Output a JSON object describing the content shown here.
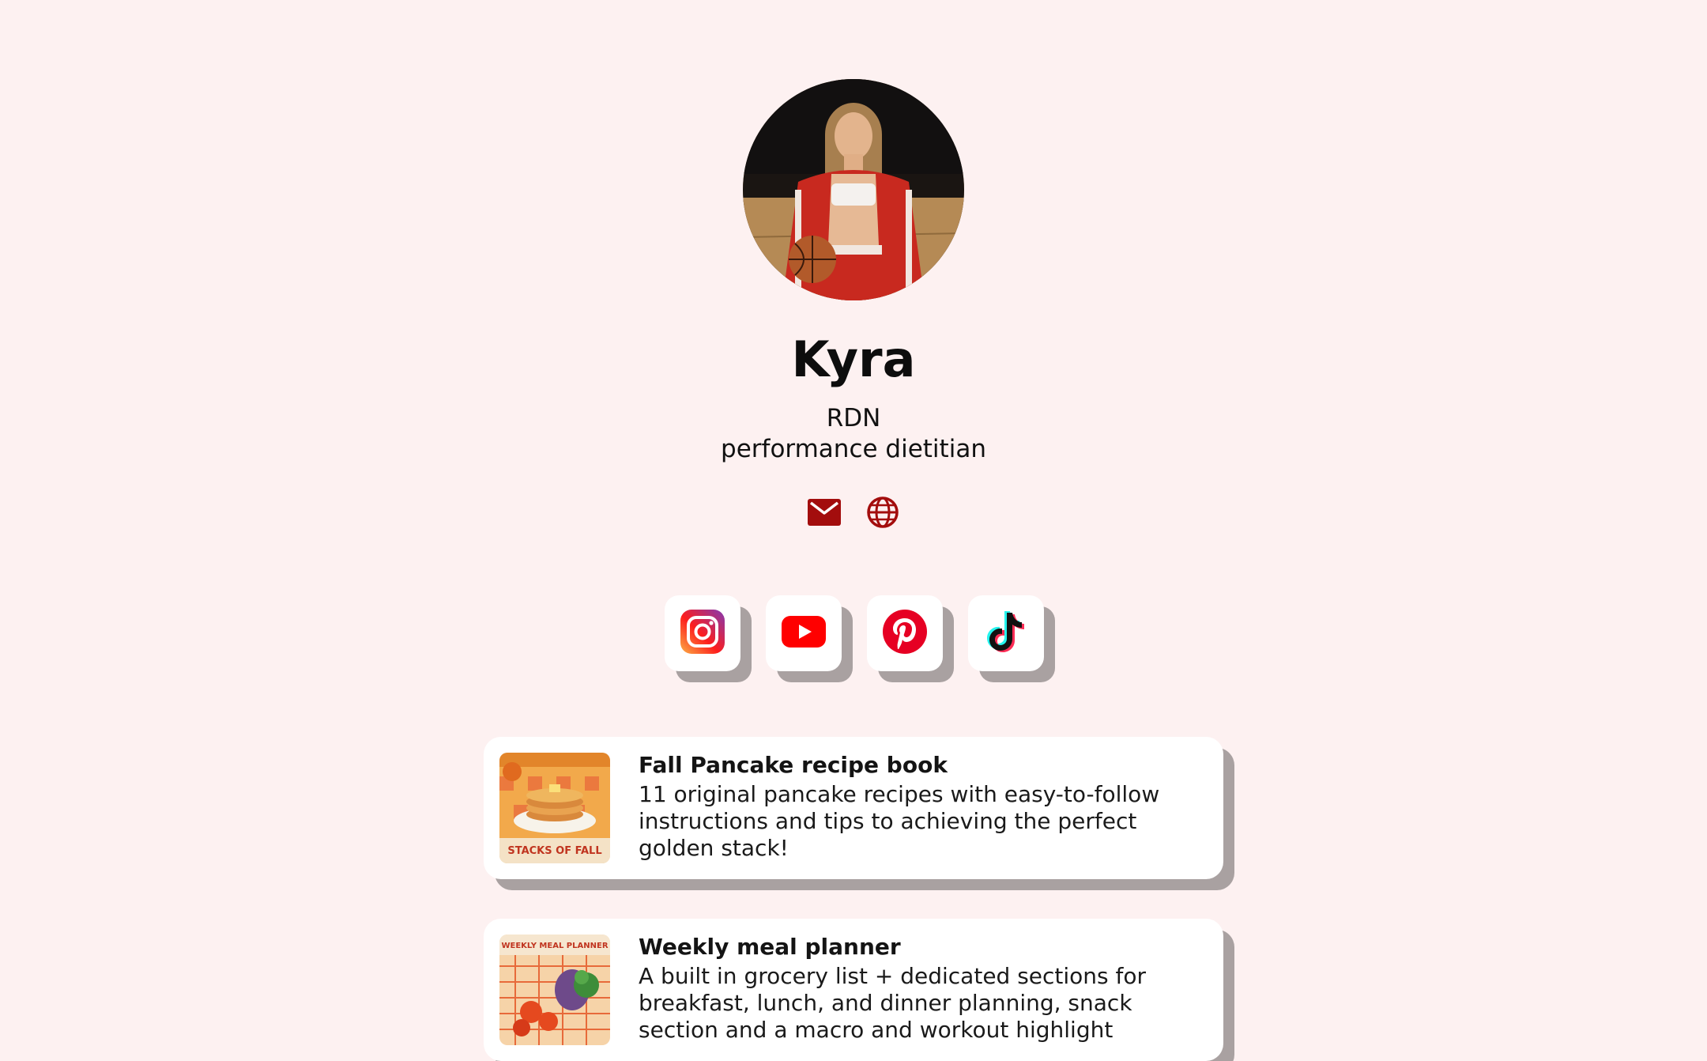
{
  "profile": {
    "name": "Kyra",
    "bio_lines": [
      "RDN",
      "performance dietitian"
    ]
  },
  "contact_icons": [
    {
      "icon": "mail-icon",
      "color": "#a30d0d"
    },
    {
      "icon": "globe-icon",
      "color": "#a30d0d"
    }
  ],
  "social_links": [
    {
      "icon": "instagram-icon"
    },
    {
      "icon": "youtube-icon"
    },
    {
      "icon": "pinterest-icon"
    },
    {
      "icon": "tiktok-icon"
    }
  ],
  "cards": [
    {
      "title": "Fall Pancake recipe book",
      "description": "11 original pancake recipes with easy-to-follow instructions and tips to achieving the perfect golden stack!",
      "thumb_text": "STACKS OF FALL"
    },
    {
      "title": "Weekly meal planner",
      "description": "A built in grocery list + dedicated sections for breakfast, lunch, and dinner planning, snack section and a macro and workout highlight",
      "thumb_text": "WEEKLY MEAL PLANNER"
    }
  ],
  "colors": {
    "background": "#fdf1f1",
    "accent": "#a30d0d",
    "card_shadow": "#a9a1a1"
  }
}
